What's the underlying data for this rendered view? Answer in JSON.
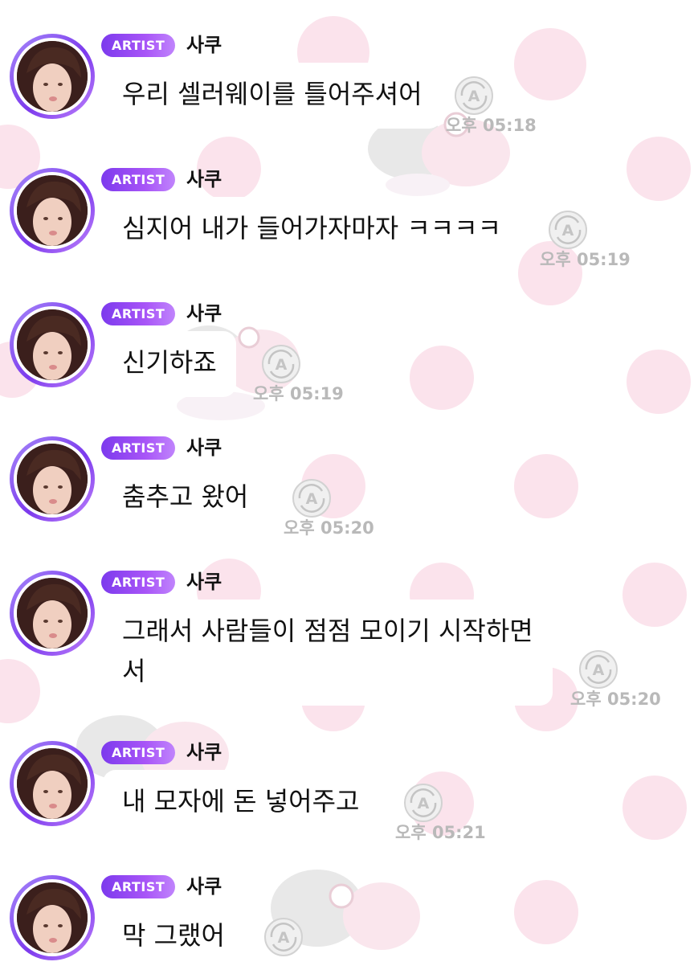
{
  "colors": {
    "badge_start": "#7c3aed",
    "badge_end": "#c084fc",
    "background_dot": "#fbe3ec",
    "timestamp": "#b9b9b9",
    "message_text": "#111111"
  },
  "icons": {
    "avatar": "artist-avatar-photo",
    "status": "a-circle-refresh-icon",
    "background": "polka-dot-pattern"
  },
  "messages": [
    {
      "badge": "ARTIST",
      "sender": "사쿠",
      "text": "우리 셀러웨이를 틀어주셔어",
      "time": "오후 05:18"
    },
    {
      "badge": "ARTIST",
      "sender": "사쿠",
      "text": "심지어 내가 들어가자마자 ㅋㅋㅋㅋ",
      "time": "오후 05:19"
    },
    {
      "badge": "ARTIST",
      "sender": "사쿠",
      "text": "신기하죠",
      "time": "오후 05:19"
    },
    {
      "badge": "ARTIST",
      "sender": "사쿠",
      "text": "춤추고 왔어",
      "time": "오후 05:20"
    },
    {
      "badge": "ARTIST",
      "sender": "사쿠",
      "text": "그래서 사람들이 점점 모이기 시작하면\n서",
      "time": "오후 05:20"
    },
    {
      "badge": "ARTIST",
      "sender": "사쿠",
      "text": "내 모자에 돈 넣어주고",
      "time": "오후 05:21"
    },
    {
      "badge": "ARTIST",
      "sender": "사쿠",
      "text": "막 그랬어",
      "time": ""
    }
  ]
}
